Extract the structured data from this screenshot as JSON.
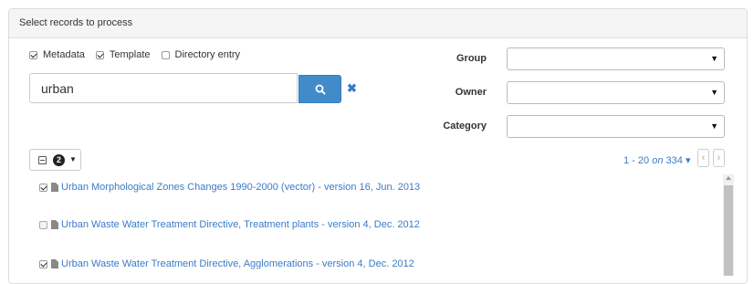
{
  "panel": {
    "title": "Select records to process"
  },
  "types": {
    "metadata": {
      "label": "Metadata",
      "checked": true
    },
    "template": {
      "label": "Template",
      "checked": true
    },
    "directory": {
      "label": "Directory entry",
      "checked": false
    }
  },
  "search": {
    "value": "urban",
    "search_icon": "search-icon",
    "clear_glyph": "✖"
  },
  "filters": {
    "group_label": "Group",
    "owner_label": "Owner",
    "category_label": "Category",
    "caret": "▼"
  },
  "selection": {
    "count": "2",
    "caret": "▼"
  },
  "pager": {
    "range": "1 - 20",
    "on": "on",
    "total": "334",
    "caret": "▾",
    "prev": "‹",
    "next": "›"
  },
  "results": [
    {
      "title": "Urban Morphological Zones Changes 1990-2000 (vector) - version 16, Jun. 2013",
      "checked": true
    },
    {
      "title": "Urban Waste Water Treatment Directive, Treatment plants - version 4, Dec. 2012",
      "checked": false
    },
    {
      "title": "Urban Waste Water Treatment Directive, Agglomerations - version 4, Dec. 2012",
      "checked": true
    }
  ],
  "colors": {
    "accent": "#428bca",
    "link": "#3a7bc8"
  }
}
